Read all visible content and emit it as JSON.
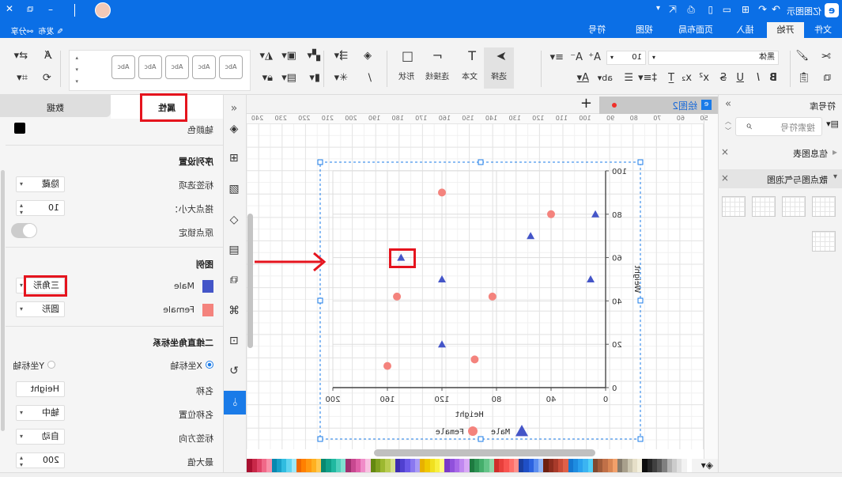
{
  "titlebar": {
    "app_name": "亿图图示",
    "window_controls": [
      "minimize",
      "maximize",
      "close"
    ]
  },
  "menubar": {
    "tabs": [
      {
        "label": "文件"
      },
      {
        "label": "开始",
        "active": true
      },
      {
        "label": "插入"
      },
      {
        "label": "页面布局"
      },
      {
        "label": "视图"
      },
      {
        "label": "符号"
      }
    ],
    "publish": "发布",
    "share": "分享"
  },
  "toolbar": {
    "font_name": "黑体",
    "font_size": "10",
    "select": "选择",
    "text": "文本",
    "connector": "连接线",
    "shape": "形状",
    "style_samples": [
      "Abc",
      "Abc",
      "Abc",
      "Abc",
      "Abc"
    ]
  },
  "library": {
    "title": "符号库",
    "search_placeholder": "搜索符号",
    "categories": [
      {
        "label": "信息图表",
        "expanded": false
      },
      {
        "label": "散点图与气泡图",
        "expanded": true
      }
    ]
  },
  "canvas": {
    "tab_label": "绘图2",
    "ruler": [
      "50",
      "60",
      "70",
      "80",
      "90",
      "100",
      "110",
      "120",
      "130",
      "140",
      "150",
      "160",
      "170",
      "180",
      "190",
      "200",
      "210",
      "220",
      "230",
      "240"
    ]
  },
  "properties": {
    "tabs": [
      {
        "label": "属性",
        "active": true
      },
      {
        "label": "数据"
      }
    ],
    "axis_color_label": "轴颜色",
    "axis_color": "#000000",
    "series_heading": "序列设置",
    "label_option_label": "标签选项",
    "label_option_value": "隐藏",
    "marker_size_label": "搭点大小：",
    "marker_size_value": "10",
    "origin_lock_label": "原点锁定",
    "origin_lock_on": false,
    "legend_heading": "图例",
    "legend": [
      {
        "name": "Male",
        "color": "#4455c8",
        "shape": "三角形"
      },
      {
        "name": "Female",
        "color": "#f4837d",
        "shape": "圆形"
      }
    ],
    "coord_heading": "二维直角坐标系",
    "x_axis_radio": "X坐标轴",
    "y_axis_radio": "Y坐标轴",
    "selected_axis": "X坐标轴",
    "name_label": "名称",
    "name_value": "Height",
    "name_pos_label": "名称位置",
    "name_pos_value": "轴中",
    "label_dir_label": "标签方向",
    "label_dir_value": "自动",
    "max_label": "最大值",
    "max_value": "200"
  },
  "chart_data": {
    "type": "scatter",
    "xlabel": "Height",
    "ylabel": "Weight",
    "xlim": [
      0,
      200
    ],
    "ylim": [
      0,
      100
    ],
    "xticks": [
      0,
      40,
      80,
      120,
      160,
      200
    ],
    "yticks": [
      0,
      20,
      40,
      60,
      80,
      100
    ],
    "legend": "bottom",
    "series": [
      {
        "name": "Male",
        "marker": "triangle",
        "color": "#4455c8",
        "points": [
          [
            7.5,
            80
          ],
          [
            55,
            70
          ],
          [
            150,
            60
          ],
          [
            120,
            50
          ],
          [
            11,
            50
          ],
          [
            120,
            20
          ]
        ]
      },
      {
        "name": "Female",
        "marker": "circle",
        "color": "#f4837d",
        "points": [
          [
            120,
            90
          ],
          [
            40,
            80
          ],
          [
            153,
            42
          ],
          [
            83,
            42
          ],
          [
            96,
            13
          ],
          [
            160,
            10
          ]
        ]
      }
    ]
  },
  "palette": [
    "#ffffff",
    "#f2f2f2",
    "#e0e0e0",
    "#cccccc",
    "#b3b3b3",
    "#808080",
    "#5a5a5a",
    "#404040",
    "#262626",
    "#0d0d0d",
    "#f3efdc",
    "#e6dfc8",
    "#ccc6b0",
    "#a9a08c",
    "#857b6c",
    "#f2a06a",
    "#d98654",
    "#c07048",
    "#a05b3a",
    "#7f4a30",
    "#4fd0f7",
    "#3bb4f2",
    "#2aa1ee",
    "#1e8ce0",
    "#1477d0",
    "#e06048",
    "#c84c38",
    "#a83a2a",
    "#8c2c1e",
    "#6e2010",
    "#8fb4f5",
    "#5b8def",
    "#2c63e0",
    "#1f4fc6",
    "#1a3ea0",
    "#ff8f8a",
    "#ff6f6a",
    "#f85450",
    "#e8403c",
    "#d02e2a",
    "#8fd6a8",
    "#64c488",
    "#45ae6c",
    "#2e9454",
    "#1e7a40",
    "#d8a8f5",
    "#c088f0",
    "#a868e8",
    "#9050dc",
    "#7a38c8",
    "#fffa80",
    "#f8f040",
    "#f0e020",
    "#f0c800",
    "#e8b000",
    "#a89af5",
    "#8a78f0",
    "#6a58e8",
    "#5040d0",
    "#3c2cb0",
    "#d4e08c",
    "#b8cc50",
    "#9cb830",
    "#80a020",
    "#648810",
    "#f8c0e0",
    "#f08cc8",
    "#e060a8",
    "#c84890",
    "#a03070",
    "#80e0d0",
    "#50d0bc",
    "#20b8a0",
    "#10a088",
    "#088870",
    "#ffc850",
    "#ffb020",
    "#ff9810",
    "#ff8000",
    "#f06800",
    "#a0e8f8",
    "#60d4f0",
    "#30bce0",
    "#18a0c8",
    "#0888b0",
    "#f890a8",
    "#f06888",
    "#e04468",
    "#c82848",
    "#a81030"
  ]
}
